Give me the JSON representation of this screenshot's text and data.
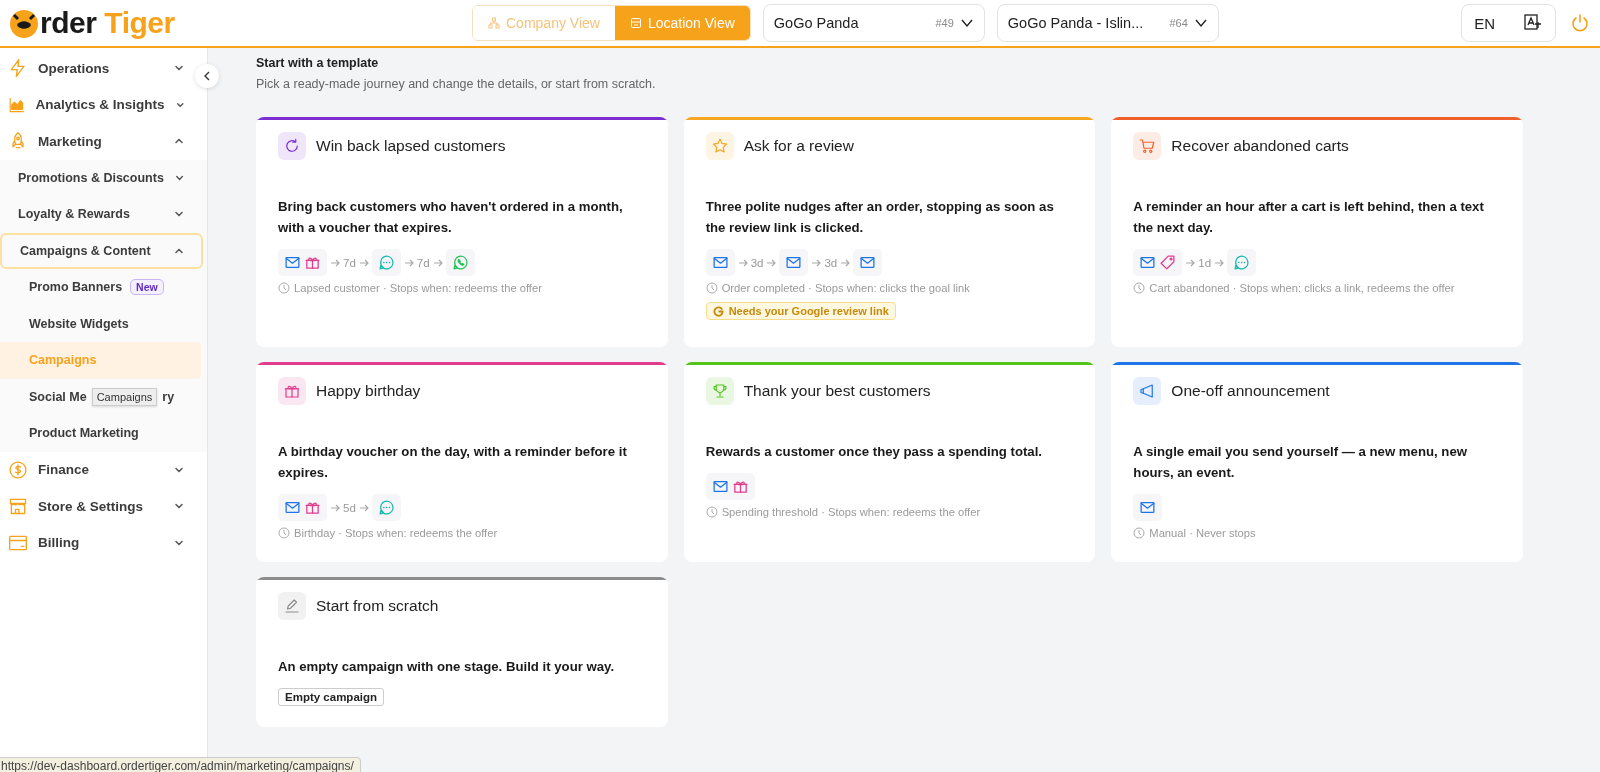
{
  "header": {
    "logo": {
      "text_dark": "rder",
      "text_accent": "Tiger"
    },
    "view_toggle": [
      {
        "label": "Company View",
        "kind": "company",
        "selected": false
      },
      {
        "label": "Location View",
        "kind": "location",
        "selected": true
      }
    ],
    "selectors": [
      {
        "value": "GoGo Panda",
        "code": "#49"
      },
      {
        "value": "GoGo Panda - Islin...",
        "code": "#64"
      }
    ],
    "language": "EN"
  },
  "sidebar": {
    "items": [
      {
        "kind": "operations",
        "label": "Operations",
        "expanded": false
      },
      {
        "kind": "analytics",
        "label": "Analytics & Insights",
        "expanded": false
      },
      {
        "kind": "marketing",
        "label": "Marketing",
        "expanded": true,
        "children": [
          {
            "label": "Promotions & Discounts",
            "expanded": false,
            "focused": false
          },
          {
            "label": "Loyalty & Rewards",
            "expanded": false,
            "focused": false
          },
          {
            "label": "Campaigns & Content",
            "expanded": true,
            "focused": true,
            "children": [
              {
                "label": "Promo Banners",
                "badge": "New",
                "selected": false
              },
              {
                "label": "Website Widgets",
                "selected": false
              },
              {
                "label": "Campaigns",
                "selected": true
              },
              {
                "label": "Social Me",
                "label_end": "ry",
                "tooltip": "Campaigns",
                "selected": false
              },
              {
                "label": "Product Marketing",
                "selected": false
              }
            ]
          }
        ]
      },
      {
        "kind": "finance",
        "label": "Finance",
        "expanded": false
      },
      {
        "kind": "store",
        "label": "Store & Settings",
        "expanded": false
      },
      {
        "kind": "billing",
        "label": "Billing",
        "expanded": false
      }
    ]
  },
  "main": {
    "title": "Start with a template",
    "subtitle": "Pick a ready-made journey and change the details, or start from scratch.",
    "templates": [
      {
        "kind": "winback",
        "color": "#7b2fd0",
        "title": "Win back lapsed customers",
        "description": "Bring back customers who haven't ordered in a month, with a voucher that expires.",
        "steps": [
          {
            "kind": "channels",
            "channels": [
              {
                "kind": "email"
              },
              {
                "kind": "gift"
              }
            ]
          },
          {
            "kind": "delay",
            "text": "7d"
          },
          {
            "kind": "channels",
            "channels": [
              {
                "kind": "chat"
              }
            ]
          },
          {
            "kind": "delay",
            "text": "7d"
          },
          {
            "kind": "channels",
            "channels": [
              {
                "kind": "whatsapp"
              }
            ]
          }
        ],
        "meta": "Lapsed customer · Stops when: redeems the offer"
      },
      {
        "kind": "review",
        "color": "#f5a623",
        "title": "Ask for a review",
        "description": "Three polite nudges after an order, stopping as soon as the review link is clicked.",
        "steps": [
          {
            "kind": "channels",
            "channels": [
              {
                "kind": "email"
              }
            ]
          },
          {
            "kind": "delay",
            "text": "3d"
          },
          {
            "kind": "channels",
            "channels": [
              {
                "kind": "email"
              }
            ]
          },
          {
            "kind": "delay",
            "text": "3d"
          },
          {
            "kind": "channels",
            "channels": [
              {
                "kind": "email"
              }
            ]
          }
        ],
        "meta": "Order completed · Stops when: clicks the goal link",
        "warning": "Needs your Google review link"
      },
      {
        "kind": "cart",
        "color": "#f0602a",
        "title": "Recover abandoned carts",
        "description": "A reminder an hour after a cart is left behind, then a text the next day.",
        "steps": [
          {
            "kind": "channels",
            "channels": [
              {
                "kind": "email"
              },
              {
                "kind": "tag"
              }
            ]
          },
          {
            "kind": "delay",
            "text": "1d"
          },
          {
            "kind": "channels",
            "channels": [
              {
                "kind": "chat"
              }
            ]
          }
        ],
        "meta": "Cart abandoned · Stops when: clicks a link, redeems the offer"
      },
      {
        "kind": "birthday",
        "color": "#e23c8e",
        "title": "Happy birthday",
        "description": "A birthday voucher on the day, with a reminder before it expires.",
        "steps": [
          {
            "kind": "channels",
            "channels": [
              {
                "kind": "email"
              },
              {
                "kind": "gift"
              }
            ]
          },
          {
            "kind": "delay",
            "text": "5d"
          },
          {
            "kind": "channels",
            "channels": [
              {
                "kind": "chat"
              }
            ]
          }
        ],
        "meta": "Birthday · Stops when: redeems the offer"
      },
      {
        "kind": "loyalty",
        "color": "#52c41a",
        "title": "Thank your best customers",
        "description": "Rewards a customer once they pass a spending total.",
        "steps": [
          {
            "kind": "channels",
            "channels": [
              {
                "kind": "email"
              },
              {
                "kind": "gift"
              }
            ]
          }
        ],
        "meta": "Spending threshold · Stops when: redeems the offer"
      },
      {
        "kind": "announcement",
        "color": "#1f74e8",
        "title": "One-off announcement",
        "description": "A single email you send yourself — a new menu, new hours, an event.",
        "steps": [
          {
            "kind": "channels",
            "channels": [
              {
                "kind": "email"
              }
            ]
          }
        ],
        "meta": "Manual · Never stops"
      },
      {
        "kind": "scratch",
        "color": "#8c8c8c",
        "title": "Start from scratch",
        "description": "An empty campaign with one stage. Build it your way.",
        "tag": "Empty campaign"
      }
    ]
  },
  "status_url": "https://dev-dashboard.ordertiger.com/admin/marketing/campaigns/"
}
